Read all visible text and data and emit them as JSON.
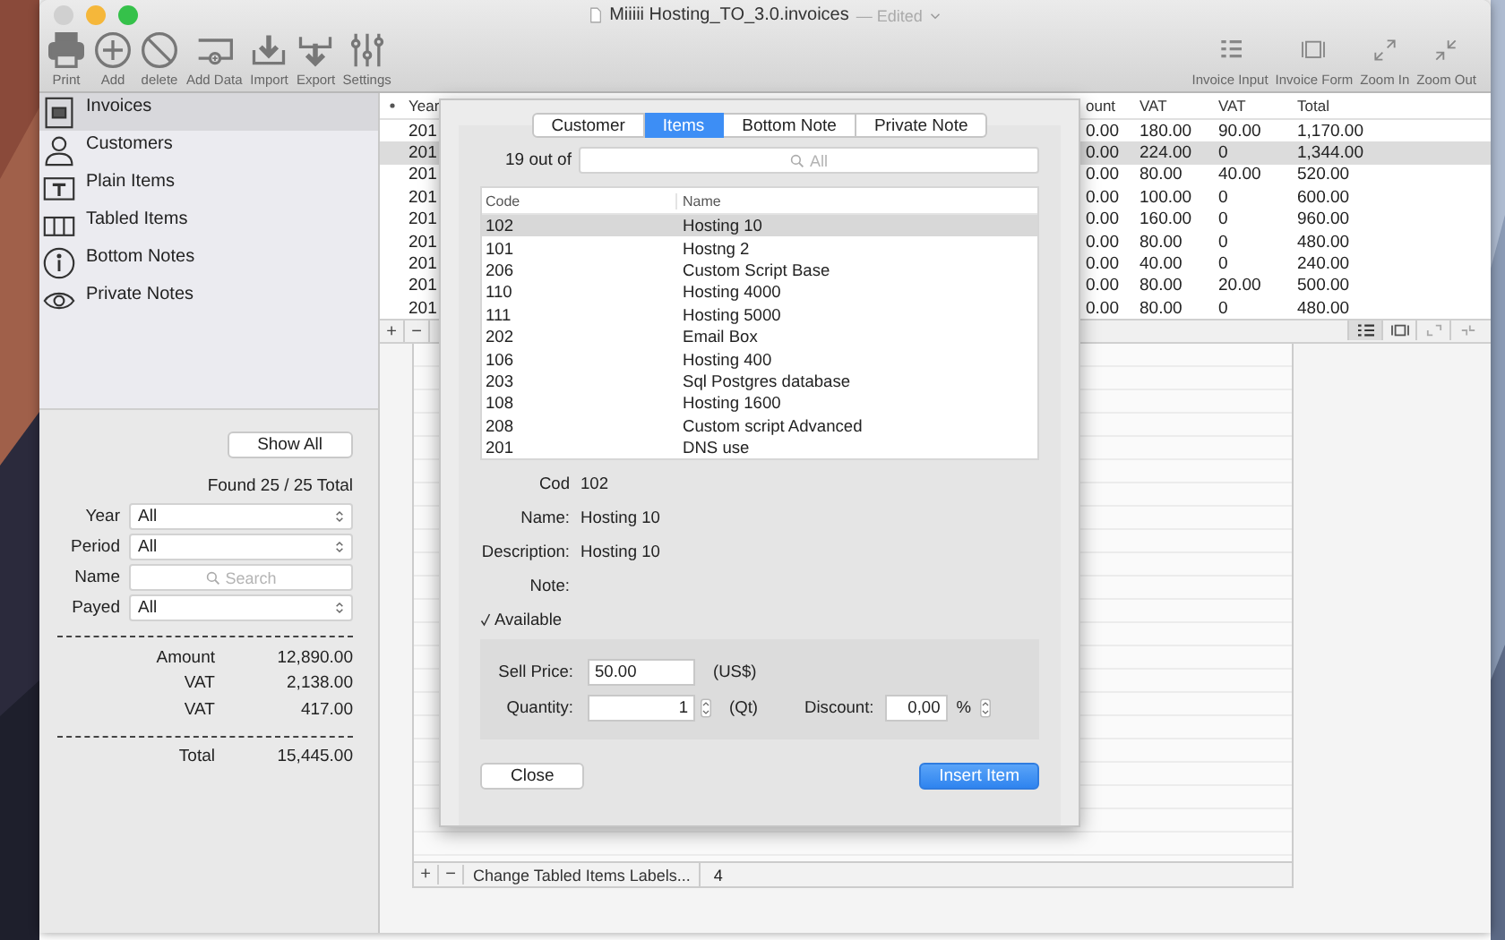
{
  "window": {
    "title": "Miiiii Hosting_TO_3.0.invoices",
    "status": "— Edited"
  },
  "toolbar": {
    "left": [
      {
        "label": "Print"
      },
      {
        "label": "Add"
      },
      {
        "label": "delete"
      },
      {
        "label": "Add Data"
      },
      {
        "label": "Import"
      },
      {
        "label": "Export"
      },
      {
        "label": "Settings"
      }
    ],
    "right": [
      {
        "label": "Invoice Input"
      },
      {
        "label": "Invoice Form"
      },
      {
        "label": "Zoom In"
      },
      {
        "label": "Zoom Out"
      }
    ]
  },
  "sidebar": {
    "items": [
      {
        "label": "Invoices",
        "selected": true
      },
      {
        "label": "Customers",
        "selected": false
      },
      {
        "label": "Plain Items",
        "selected": false
      },
      {
        "label": "Tabled Items",
        "selected": false
      },
      {
        "label": "Bottom Notes",
        "selected": false
      },
      {
        "label": "Private Notes",
        "selected": false
      }
    ]
  },
  "filter_panel": {
    "show_all": "Show All",
    "found": "Found 25 / 25 Total",
    "filters": [
      {
        "label": "Year",
        "kind": "select",
        "value": "All"
      },
      {
        "label": "Period",
        "kind": "select",
        "value": "All"
      },
      {
        "label": "Name",
        "kind": "search",
        "placeholder": "Search"
      },
      {
        "label": "Payed",
        "kind": "select",
        "value": "All"
      }
    ],
    "totals": [
      {
        "label": "Amount",
        "value": "12,890.00"
      },
      {
        "label": "VAT",
        "value": "2,138.00"
      },
      {
        "label": "VAT",
        "value": "417.00"
      }
    ],
    "grand_total": {
      "label": "Total",
      "value": "15,445.00"
    }
  },
  "invoice_table": {
    "columns": [
      "Year",
      "ount",
      "VAT",
      "VAT",
      "Total"
    ],
    "rows": [
      {
        "cells": [
          "201",
          "0.00",
          "180.00",
          "90.00",
          "1,170.00"
        ],
        "selected": false
      },
      {
        "cells": [
          "201",
          "0.00",
          "224.00",
          "0",
          "1,344.00"
        ],
        "selected": true
      },
      {
        "cells": [
          "201",
          "0.00",
          "80.00",
          "40.00",
          "520.00"
        ],
        "selected": false
      },
      {
        "cells": [
          "201",
          "0.00",
          "100.00",
          "0",
          "600.00"
        ],
        "selected": false
      },
      {
        "cells": [
          "201",
          "0.00",
          "160.00",
          "0",
          "960.00"
        ],
        "selected": false
      },
      {
        "cells": [
          "201",
          "0.00",
          "80.00",
          "0",
          "480.00"
        ],
        "selected": false
      },
      {
        "cells": [
          "201",
          "0.00",
          "40.00",
          "0",
          "240.00"
        ],
        "selected": false
      },
      {
        "cells": [
          "201",
          "0.00",
          "80.00",
          "20.00",
          "500.00"
        ],
        "selected": false
      },
      {
        "cells": [
          "201",
          "0.00",
          "80.00",
          "0",
          "480.00"
        ],
        "selected": false
      }
    ],
    "controls": [
      "+",
      "−"
    ]
  },
  "sheet": {
    "tabs": [
      {
        "label": "Customer",
        "selected": false
      },
      {
        "label": "Items",
        "selected": true
      },
      {
        "label": "Bottom Note",
        "selected": false
      },
      {
        "label": "Private Note",
        "selected": false
      }
    ],
    "count_label": "19 out of",
    "search_placeholder": "All",
    "columns": [
      "Code",
      "Name"
    ],
    "rows": [
      {
        "code": "102",
        "name": "Hosting 10",
        "selected": true
      },
      {
        "code": "101",
        "name": "Hostng 2",
        "selected": false
      },
      {
        "code": "206",
        "name": "Custom Script Base",
        "selected": false
      },
      {
        "code": "110",
        "name": "Hosting 4000",
        "selected": false
      },
      {
        "code": "111",
        "name": "Hosting 5000",
        "selected": false
      },
      {
        "code": "202",
        "name": "Email Box",
        "selected": false
      },
      {
        "code": "106",
        "name": "Hosting 400",
        "selected": false
      },
      {
        "code": "203",
        "name": "Sql Postgres database",
        "selected": false
      },
      {
        "code": "108",
        "name": "Hosting 1600",
        "selected": false
      },
      {
        "code": "208",
        "name": "Custom script Advanced",
        "selected": false
      },
      {
        "code": "201",
        "name": "DNS use",
        "selected": false
      }
    ],
    "details": [
      {
        "label": "Cod",
        "value": "102"
      },
      {
        "label": "Name:",
        "value": "Hosting 10"
      },
      {
        "label": "Description:",
        "value": "Hosting 10"
      },
      {
        "label": "Note:"
      }
    ],
    "available": {
      "label": "Available",
      "checked": true
    },
    "sell_price": {
      "label": "Sell Price:",
      "value": "50.00",
      "unit": "(US$)"
    },
    "quantity": {
      "label": "Quantity:",
      "value": "1",
      "unit": "(Qt)"
    },
    "discount": {
      "label": "Discount:",
      "value": "0,00",
      "unit": "%"
    },
    "close": "Close",
    "insert": "Insert Item"
  },
  "lower_table": {
    "controls": [
      "+",
      "−"
    ],
    "button": "Change Tabled Items Labels...",
    "count": "4"
  }
}
